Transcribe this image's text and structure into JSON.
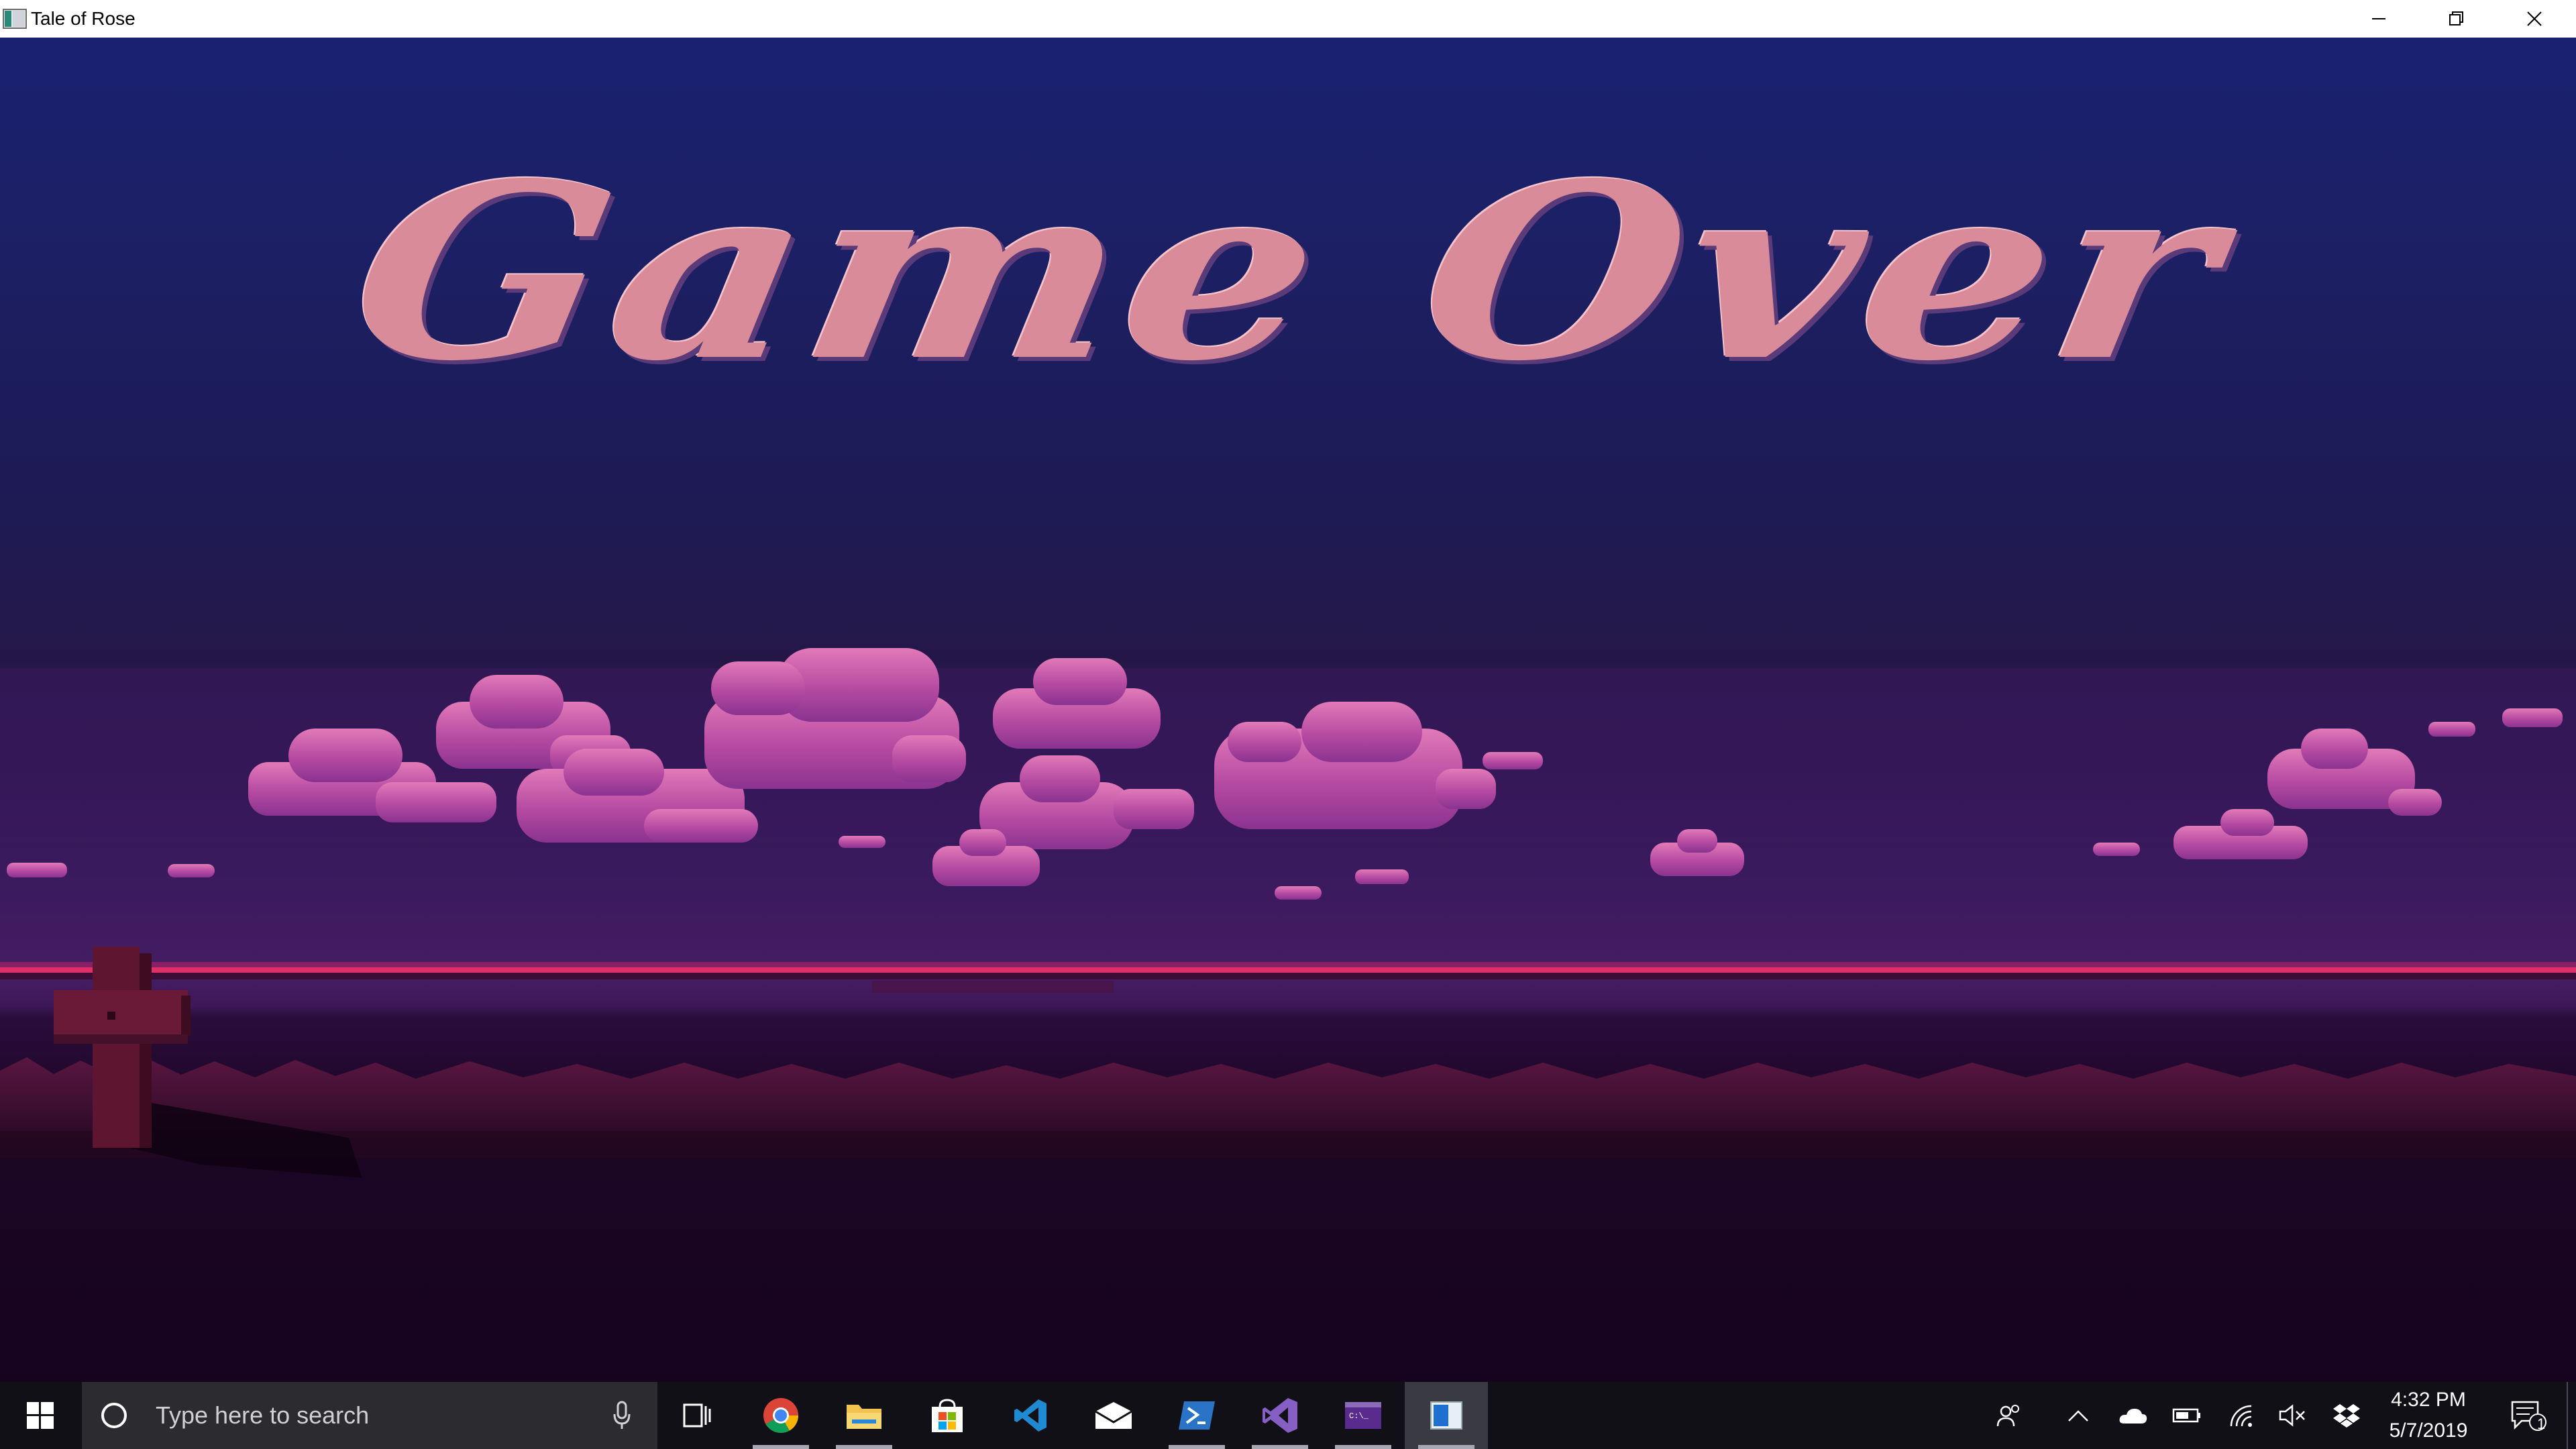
{
  "window": {
    "title": "Tale of Rose",
    "icons": [
      "app-icon",
      "minimize-icon",
      "restore-icon",
      "close-icon"
    ]
  },
  "game": {
    "title": "Game Over",
    "scene": [
      "night-sky",
      "pink-pixel-clouds",
      "horizon",
      "grave-cross",
      "grass"
    ]
  },
  "taskbar": {
    "search_placeholder": "Type here to search",
    "apps": [
      "task-view",
      "chrome",
      "file-explorer",
      "microsoft-store",
      "vscode",
      "mail",
      "powershell",
      "visual-studio",
      "terminal",
      "tale-of-rose"
    ],
    "tray": [
      "people",
      "show-hidden-icons",
      "onedrive",
      "battery",
      "wifi",
      "volume-muted",
      "dropbox"
    ],
    "time": "4:32 PM",
    "date": "5/7/2019",
    "notification_count": "1"
  },
  "colors": {
    "title_text": "#d98b99",
    "sky_top": "#1a2170",
    "horizon": "#e0306a",
    "taskbar": "#101016"
  }
}
